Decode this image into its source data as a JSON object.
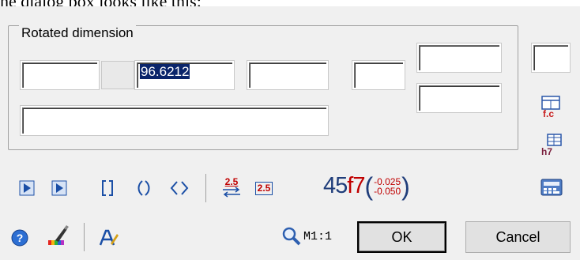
{
  "intro_text": "he dialog box looks like this:",
  "group": {
    "title": "Rotated dimension"
  },
  "fields": {
    "prefix": "",
    "value": "96.6212",
    "suffix": "",
    "tolerance": "",
    "upper_deviation": "",
    "lower_deviation": "",
    "side_box": "",
    "note": ""
  },
  "toolbar": {
    "text_25_top": "2.5",
    "text_25_box": "2.5"
  },
  "tolerance_display": {
    "nominal": "45",
    "fit": "f7",
    "upper": "-0.025",
    "lower": "-0.050"
  },
  "bottom": {
    "zoom_label": "M1:1",
    "ok_label": "OK",
    "cancel_label": "Cancel"
  },
  "side_icons": {
    "fit_label": "f.c",
    "table_label": "h7"
  },
  "colors": {
    "dialog_bg": "#f0f0f0",
    "selection_bg": "#0a246a",
    "tolerance_text": "#1f3d7a",
    "tolerance_deviation": "#c00000",
    "icon_blue": "#1b4fa6"
  }
}
